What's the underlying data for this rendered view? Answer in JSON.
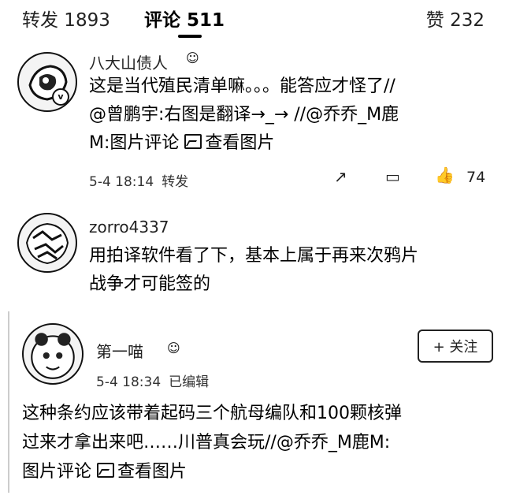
{
  "tabs": {
    "repost": "转发 1893",
    "comments": "评论 511",
    "likes": "赞 232"
  },
  "comments": [
    {
      "username": "八大山债人",
      "text_line1": "这是当代殖民清单嘛。。。能答应才怪了//",
      "text_line2": "@曾鹏宇:右图是翻译→_→ //@乔乔_M鹿",
      "text_line3_a": "M:图片评论 ",
      "text_line3_link": "查看图片",
      "time": "5-4 18:14",
      "repost_label": "转发",
      "like_count": "74"
    },
    {
      "username": "zorro4337",
      "text_line1": "用拍译软件看了下，基本上属于再来次鸦片",
      "text_line2": "战争才可能签的"
    },
    {
      "username": "第一喵",
      "time": "5-4 18:34",
      "edited": "已编辑",
      "follow_label": "+ 关注",
      "text_line1": "这种条约应该带着起码三个航母编队和100颗核弹",
      "text_line2": "过来才拿出来吧……川普真会玩//@乔乔_M鹿M:",
      "text_line3_a": "图片评论 ",
      "text_line3_link": "查看图片"
    }
  ]
}
